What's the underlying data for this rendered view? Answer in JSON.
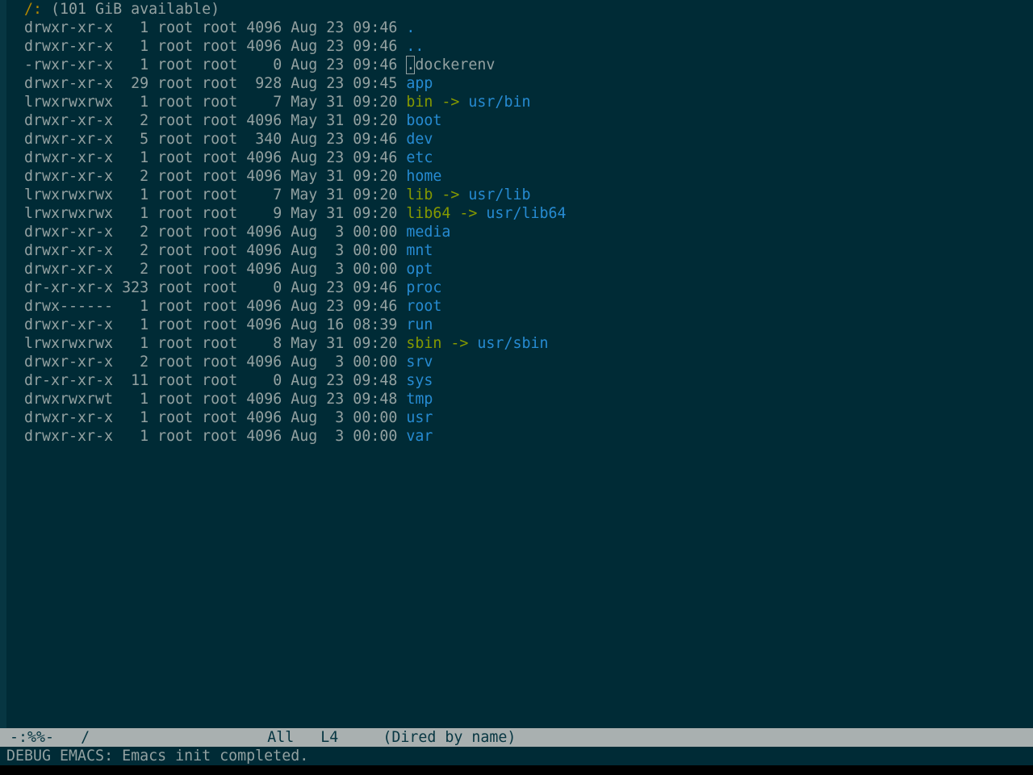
{
  "header": {
    "path": "/:",
    "available": " (101 GiB available)"
  },
  "listing": [
    {
      "perm": "drwxr-xr-x",
      "links": "  1",
      "owner": "root",
      "group": "root",
      "size": "4096",
      "date": "Aug 23 09:46",
      "name": ".",
      "type": "dir"
    },
    {
      "perm": "drwxr-xr-x",
      "links": "  1",
      "owner": "root",
      "group": "root",
      "size": "4096",
      "date": "Aug 23 09:46",
      "name": "..",
      "type": "dir"
    },
    {
      "perm": "-rwxr-xr-x",
      "links": "  1",
      "owner": "root",
      "group": "root",
      "size": "   0",
      "date": "Aug 23 09:46",
      "name": ".dockerenv",
      "type": "file"
    },
    {
      "perm": "drwxr-xr-x",
      "links": " 29",
      "owner": "root",
      "group": "root",
      "size": " 928",
      "date": "Aug 23 09:45",
      "name": "app",
      "type": "dir"
    },
    {
      "perm": "lrwxrwxrwx",
      "links": "  1",
      "owner": "root",
      "group": "root",
      "size": "   7",
      "date": "May 31 09:20",
      "name": "bin",
      "type": "link",
      "target": "usr/bin"
    },
    {
      "perm": "drwxr-xr-x",
      "links": "  2",
      "owner": "root",
      "group": "root",
      "size": "4096",
      "date": "May 31 09:20",
      "name": "boot",
      "type": "dir"
    },
    {
      "perm": "drwxr-xr-x",
      "links": "  5",
      "owner": "root",
      "group": "root",
      "size": " 340",
      "date": "Aug 23 09:46",
      "name": "dev",
      "type": "dir"
    },
    {
      "perm": "drwxr-xr-x",
      "links": "  1",
      "owner": "root",
      "group": "root",
      "size": "4096",
      "date": "Aug 23 09:46",
      "name": "etc",
      "type": "dir"
    },
    {
      "perm": "drwxr-xr-x",
      "links": "  2",
      "owner": "root",
      "group": "root",
      "size": "4096",
      "date": "May 31 09:20",
      "name": "home",
      "type": "dir"
    },
    {
      "perm": "lrwxrwxrwx",
      "links": "  1",
      "owner": "root",
      "group": "root",
      "size": "   7",
      "date": "May 31 09:20",
      "name": "lib",
      "type": "link",
      "target": "usr/lib"
    },
    {
      "perm": "lrwxrwxrwx",
      "links": "  1",
      "owner": "root",
      "group": "root",
      "size": "   9",
      "date": "May 31 09:20",
      "name": "lib64",
      "type": "link",
      "target": "usr/lib64"
    },
    {
      "perm": "drwxr-xr-x",
      "links": "  2",
      "owner": "root",
      "group": "root",
      "size": "4096",
      "date": "Aug  3 00:00",
      "name": "media",
      "type": "dir"
    },
    {
      "perm": "drwxr-xr-x",
      "links": "  2",
      "owner": "root",
      "group": "root",
      "size": "4096",
      "date": "Aug  3 00:00",
      "name": "mnt",
      "type": "dir"
    },
    {
      "perm": "drwxr-xr-x",
      "links": "  2",
      "owner": "root",
      "group": "root",
      "size": "4096",
      "date": "Aug  3 00:00",
      "name": "opt",
      "type": "dir"
    },
    {
      "perm": "dr-xr-xr-x",
      "links": "323",
      "owner": "root",
      "group": "root",
      "size": "   0",
      "date": "Aug 23 09:46",
      "name": "proc",
      "type": "dir"
    },
    {
      "perm": "drwx------",
      "links": "  1",
      "owner": "root",
      "group": "root",
      "size": "4096",
      "date": "Aug 23 09:46",
      "name": "root",
      "type": "dir"
    },
    {
      "perm": "drwxr-xr-x",
      "links": "  1",
      "owner": "root",
      "group": "root",
      "size": "4096",
      "date": "Aug 16 08:39",
      "name": "run",
      "type": "dir"
    },
    {
      "perm": "lrwxrwxrwx",
      "links": "  1",
      "owner": "root",
      "group": "root",
      "size": "   8",
      "date": "May 31 09:20",
      "name": "sbin",
      "type": "link",
      "target": "usr/sbin"
    },
    {
      "perm": "drwxr-xr-x",
      "links": "  2",
      "owner": "root",
      "group": "root",
      "size": "4096",
      "date": "Aug  3 00:00",
      "name": "srv",
      "type": "dir"
    },
    {
      "perm": "dr-xr-xr-x",
      "links": " 11",
      "owner": "root",
      "group": "root",
      "size": "   0",
      "date": "Aug 23 09:48",
      "name": "sys",
      "type": "dir"
    },
    {
      "perm": "drwxrwxrwt",
      "links": "  1",
      "owner": "root",
      "group": "root",
      "size": "4096",
      "date": "Aug 23 09:48",
      "name": "tmp",
      "type": "dir"
    },
    {
      "perm": "drwxr-xr-x",
      "links": "  1",
      "owner": "root",
      "group": "root",
      "size": "4096",
      "date": "Aug  3 00:00",
      "name": "usr",
      "type": "dir"
    },
    {
      "perm": "drwxr-xr-x",
      "links": "  1",
      "owner": "root",
      "group": "root",
      "size": "4096",
      "date": "Aug  3 00:00",
      "name": "var",
      "type": "dir"
    }
  ],
  "modeline": {
    "status": "-:%%-",
    "buffer": "/",
    "position": "All",
    "line": "L4",
    "mode": "(Dired by name)"
  },
  "echo_area": "DEBUG EMACS: Emacs init completed.",
  "colors": {
    "background": "#002b36",
    "fringe": "#073642",
    "foreground": "#93a1a1",
    "directory": "#268bd2",
    "symlink": "#859900",
    "header": "#b58900",
    "modeline_bg": "#a9b0b0"
  }
}
